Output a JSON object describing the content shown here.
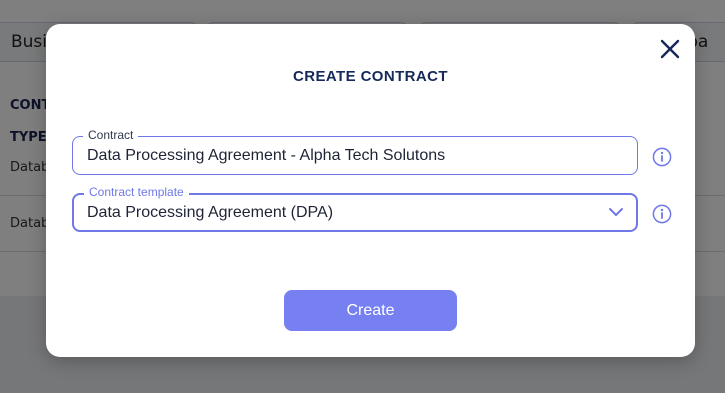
{
  "background": {
    "tabs": [
      "Busin",
      "",
      "",
      "terpa"
    ],
    "column_header_line1": "CONT",
    "column_header_line2": "TYPE",
    "rows": [
      "Datab",
      "Datab"
    ]
  },
  "modal": {
    "title": "CREATE CONTRACT",
    "contract_field": {
      "label": "Contract",
      "value": "Data Processing Agreement - Alpha Tech Solutons"
    },
    "template_field": {
      "label": "Contract template",
      "value": "Data Processing Agreement (DPA)"
    },
    "create_label": "Create",
    "icons": {
      "close": "close-icon",
      "info": "info-icon",
      "chevron": "chevron-down-icon"
    }
  },
  "colors": {
    "accent": "#6f78e6",
    "button": "#7680f0",
    "title": "#16295a"
  }
}
